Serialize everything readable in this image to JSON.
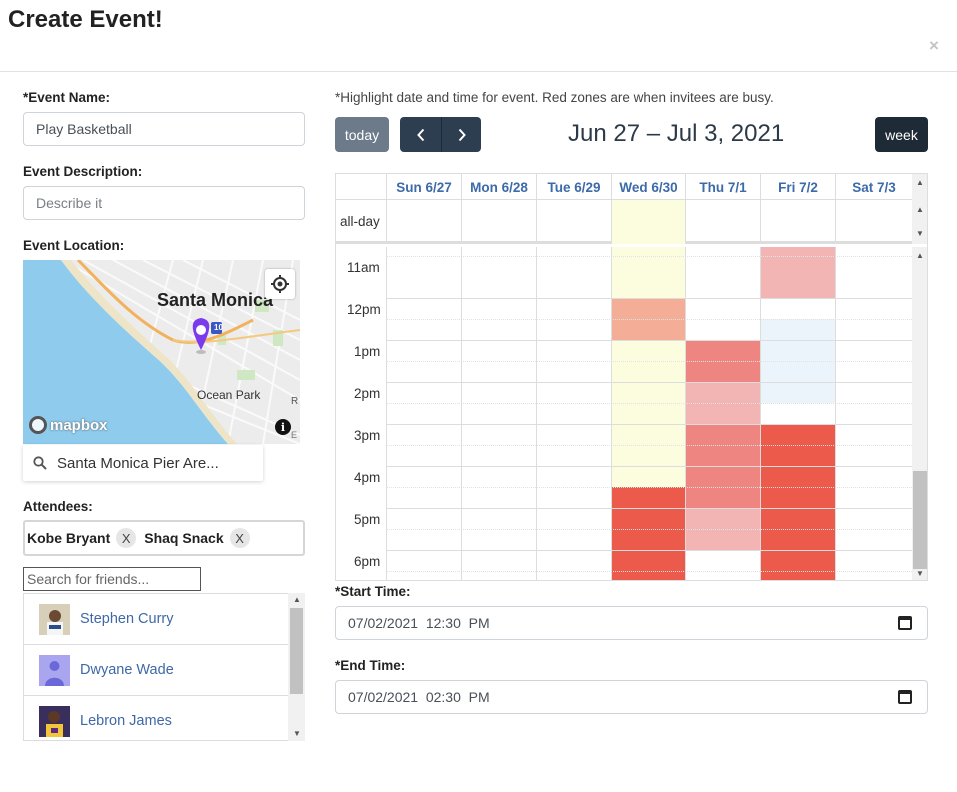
{
  "modal": {
    "title": "Create Event!",
    "close": "×"
  },
  "form": {
    "event_name_label": "*Event Name:",
    "event_name_value": "Play Basketball",
    "description_label": "Event Description:",
    "description_placeholder": "Describe it",
    "location_label": "Event Location:",
    "attendees_label": "Attendees:",
    "start_label": "*Start Time:",
    "start_value": "07/02/2021  12:30  PM",
    "end_label": "*End Time:",
    "end_value": "07/02/2021  02:30  PM"
  },
  "map": {
    "city": "Santa Monica",
    "area": "Ocean Park",
    "brand": "mapbox",
    "highway": "10",
    "search_value": "Santa Monica Pier Are...",
    "edge_text_1": "R",
    "edge_text_2": "E"
  },
  "attendees": [
    {
      "name": "Kobe Bryant",
      "remove": "X"
    },
    {
      "name": "Shaq Snack",
      "remove": "X"
    }
  ],
  "friends": {
    "search_placeholder": "Search for friends...",
    "items": [
      {
        "name": "Stephen Curry"
      },
      {
        "name": "Dwyane Wade"
      },
      {
        "name": "Lebron James"
      }
    ]
  },
  "calendar": {
    "hint": "*Highlight date and time for event. Red zones are when invitees are busy.",
    "today_label": "today",
    "prev_icon": "‹",
    "next_icon": "›",
    "week_label": "week",
    "title": "Jun 27 – Jul 3, 2021",
    "days": [
      "Sun 6/27",
      "Mon 6/28",
      "Tue 6/29",
      "Wed 6/30",
      "Thu 7/1",
      "Fri 7/2",
      "Sat 7/3"
    ],
    "allday_label": "all-day",
    "time_labels": [
      "11am",
      "12pm",
      "1pm",
      "2pm",
      "3pm",
      "4pm",
      "5pm",
      "6pm"
    ],
    "colors": {
      "today_bg": "#fcfcdf",
      "busy_dark": "#ec5a4c",
      "busy_mid": "#ee8580",
      "busy_light": "#f3b4b4",
      "busy_peach": "#f4ae98",
      "selected": "#ebf3fb"
    }
  }
}
